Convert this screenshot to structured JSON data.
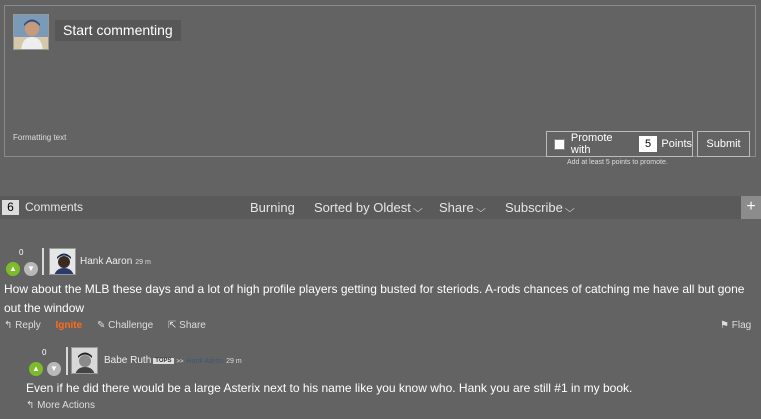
{
  "composer": {
    "start_label": "Start commenting",
    "formatting_label": "Formatting text",
    "promote_label": "Promote with",
    "points_value": "5",
    "points_label": "Points",
    "submit_label": "Submit",
    "promote_hint": "Add at least 5 points to promote."
  },
  "toolbar": {
    "count": "6",
    "comments_label": "Comments",
    "burning_label": "Burning",
    "sort_label": "Sorted by Oldest",
    "share_label": "Share",
    "subscribe_label": "Subscribe",
    "plus_label": "+"
  },
  "comments": [
    {
      "votes": "0",
      "author": "Hank Aaron",
      "time": "29 m",
      "text": "How about the MLB these days and a lot of high profile players getting busted for steriods. A-rods chances of catching me have all but gone out the window",
      "actions": {
        "reply": "Reply",
        "ignite": "Ignite",
        "challenge": "Challenge",
        "share": "Share",
        "flag": "Flag"
      }
    },
    {
      "votes": "0",
      "author": "Babe Ruth",
      "badge": "TOPS",
      "reply_to": "Hank Aaron",
      "time": "29 m",
      "text": "Even if he did there would be a large Asterix next to his name like you know who. Hank you are still #1 in my book.",
      "actions": {
        "more": "More Actions"
      }
    }
  ],
  "colors": {
    "background": "#636363",
    "upvote": "#7ebb2a",
    "ignite": "#ff6b1a",
    "toolbar": "#5a5a5a"
  }
}
